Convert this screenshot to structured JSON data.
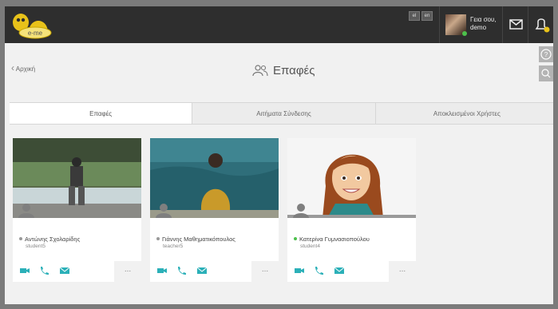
{
  "app": {
    "logo_text": "e-me"
  },
  "topbar": {
    "lang_options": [
      "el",
      "en"
    ],
    "user_greeting_line1": "Γεια σου,",
    "user_greeting_line2": "demo"
  },
  "nav": {
    "back_label": "Αρχική"
  },
  "page": {
    "title": "Επαφές"
  },
  "tabs": [
    {
      "label": "Επαφές",
      "active": true
    },
    {
      "label": "Αιτήματα Σύνδεσης",
      "active": false
    },
    {
      "label": "Αποκλεισμένοι Χρήστες",
      "active": false
    }
  ],
  "contacts": [
    {
      "name": "Αντώνης Σχολαρίδης",
      "username": "student5",
      "status": "offline",
      "status_color": "#999999"
    },
    {
      "name": "Γιάννης Μαθηματικόπουλος",
      "username": "teacher5",
      "status": "offline",
      "status_color": "#999999"
    },
    {
      "name": "Κατερίνα Γυμνασιοπούλου",
      "username": "student4",
      "status": "online",
      "status_color": "#4cc04c"
    }
  ],
  "card_actions": {
    "more_label": "..."
  },
  "colors": {
    "accent": "#2bb0b8",
    "topbar": "#2e2e2e",
    "brand_yellow": "#e8c21a"
  }
}
